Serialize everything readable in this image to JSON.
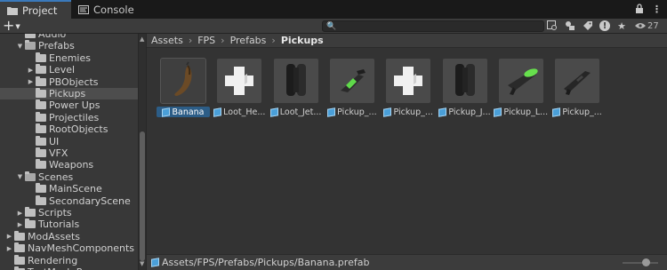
{
  "tabs": [
    {
      "label": "Project",
      "icon": "folder-icon",
      "active": true
    },
    {
      "label": "Console",
      "icon": "console-icon",
      "active": false
    }
  ],
  "tabbar_icons": [
    "lock-icon",
    "kebab-menu-icon"
  ],
  "toolbar": {
    "add_label": "+",
    "search_placeholder": "",
    "visibility_count": "27"
  },
  "tree": [
    {
      "label": "Audio",
      "depth": 2,
      "expanded": false,
      "has_children": false,
      "selected": false
    },
    {
      "label": "Prefabs",
      "depth": 2,
      "expanded": true,
      "has_children": true,
      "selected": false
    },
    {
      "label": "Enemies",
      "depth": 3,
      "expanded": false,
      "has_children": false,
      "selected": false
    },
    {
      "label": "Level",
      "depth": 3,
      "expanded": false,
      "has_children": true,
      "selected": false
    },
    {
      "label": "PBObjects",
      "depth": 3,
      "expanded": false,
      "has_children": true,
      "selected": false
    },
    {
      "label": "Pickups",
      "depth": 3,
      "expanded": false,
      "has_children": false,
      "selected": true
    },
    {
      "label": "Power Ups",
      "depth": 3,
      "expanded": false,
      "has_children": false,
      "selected": false
    },
    {
      "label": "Projectiles",
      "depth": 3,
      "expanded": false,
      "has_children": false,
      "selected": false
    },
    {
      "label": "RootObjects",
      "depth": 3,
      "expanded": false,
      "has_children": false,
      "selected": false
    },
    {
      "label": "UI",
      "depth": 3,
      "expanded": false,
      "has_children": false,
      "selected": false
    },
    {
      "label": "VFX",
      "depth": 3,
      "expanded": false,
      "has_children": false,
      "selected": false
    },
    {
      "label": "Weapons",
      "depth": 3,
      "expanded": false,
      "has_children": false,
      "selected": false
    },
    {
      "label": "Scenes",
      "depth": 2,
      "expanded": true,
      "has_children": true,
      "selected": false
    },
    {
      "label": "MainScene",
      "depth": 3,
      "expanded": false,
      "has_children": false,
      "selected": false
    },
    {
      "label": "SecondaryScene",
      "depth": 3,
      "expanded": false,
      "has_children": false,
      "selected": false
    },
    {
      "label": "Scripts",
      "depth": 2,
      "expanded": false,
      "has_children": true,
      "selected": false
    },
    {
      "label": "Tutorials",
      "depth": 2,
      "expanded": false,
      "has_children": true,
      "selected": false
    },
    {
      "label": "ModAssets",
      "depth": 1,
      "expanded": false,
      "has_children": true,
      "selected": false
    },
    {
      "label": "NavMeshComponents",
      "depth": 1,
      "expanded": false,
      "has_children": true,
      "selected": false
    },
    {
      "label": "Rendering",
      "depth": 1,
      "expanded": false,
      "has_children": false,
      "selected": false
    },
    {
      "label": "TextMesh Pro",
      "depth": 1,
      "expanded": false,
      "has_children": true,
      "selected": false
    }
  ],
  "breadcrumb": [
    "Assets",
    "FPS",
    "Prefabs",
    "Pickups"
  ],
  "assets": [
    {
      "label": "Banana",
      "thumb": "banana",
      "selected": true,
      "prefab": false
    },
    {
      "label": "Loot_He...",
      "thumb": "health-cross",
      "selected": false,
      "prefab": true
    },
    {
      "label": "Loot_Jet...",
      "thumb": "jetpack",
      "selected": false,
      "prefab": true
    },
    {
      "label": "Pickup_...",
      "thumb": "gun-green",
      "selected": false,
      "prefab": true
    },
    {
      "label": "Pickup_...",
      "thumb": "health-cross",
      "selected": false,
      "prefab": true
    },
    {
      "label": "Pickup_J...",
      "thumb": "jetpack",
      "selected": false,
      "prefab": true
    },
    {
      "label": "Pickup_L...",
      "thumb": "launcher",
      "selected": false,
      "prefab": true
    },
    {
      "label": "Pickup_...",
      "thumb": "gun-dark",
      "selected": false,
      "prefab": true
    }
  ],
  "status": {
    "path": "Assets/FPS/Prefabs/Pickups/Banana.prefab"
  }
}
